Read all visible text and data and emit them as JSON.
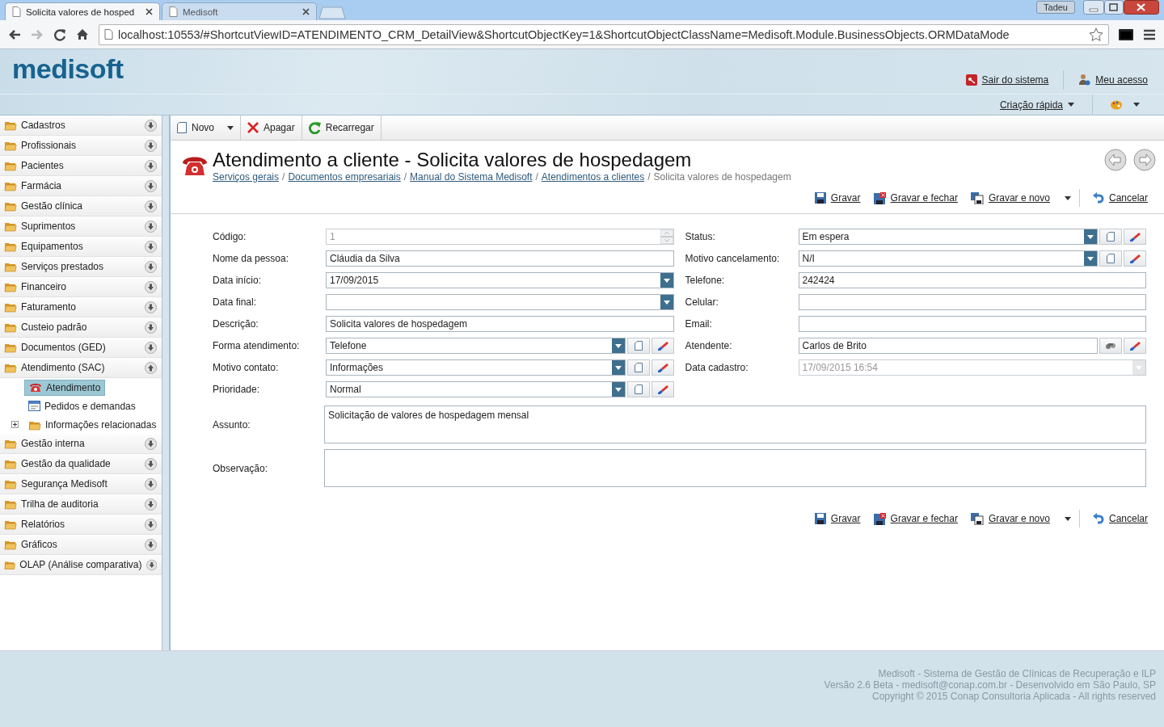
{
  "browser": {
    "tabs": [
      {
        "title": "Solicita valores de hosped",
        "selected": true
      },
      {
        "title": "Medisoft",
        "selected": false
      }
    ],
    "user": "Tadeu",
    "url": "localhost:10553/#ShortcutViewID=ATENDIMENTO_CRM_DetailView&ShortcutObjectKey=1&ShortcutObjectClassName=Medisoft.Module.BusinessObjects.ORMDataMode"
  },
  "header": {
    "logo": "medisoft",
    "links": [
      {
        "label": "Sair do sistema",
        "kind": "exit"
      },
      {
        "label": "Meu acesso",
        "kind": "user"
      }
    ],
    "quick_create": "Criação rápida"
  },
  "sidebar": {
    "items": [
      {
        "label": "Cadastros",
        "expanded": false
      },
      {
        "label": "Profissionais",
        "expanded": false
      },
      {
        "label": "Pacientes",
        "expanded": false
      },
      {
        "label": "Farmácia",
        "expanded": false
      },
      {
        "label": "Gestão clínica",
        "expanded": false
      },
      {
        "label": "Suprimentos",
        "expanded": false
      },
      {
        "label": "Equipamentos",
        "expanded": false
      },
      {
        "label": "Serviços prestados",
        "expanded": false
      },
      {
        "label": "Financeiro",
        "expanded": false
      },
      {
        "label": "Faturamento",
        "expanded": false
      },
      {
        "label": "Custeio padrão",
        "expanded": false
      },
      {
        "label": "Documentos (GED)",
        "expanded": false
      },
      {
        "label": "Atendimento (SAC)",
        "expanded": true,
        "children": [
          {
            "label": "Atendimento",
            "kind": "phone",
            "selected": true,
            "expandable": false
          },
          {
            "label": "Pedidos e demandas",
            "kind": "form",
            "selected": false,
            "expandable": false
          },
          {
            "label": "Informações relacionadas",
            "kind": "folder",
            "selected": false,
            "expandable": true
          }
        ]
      },
      {
        "label": "Gestão interna",
        "expanded": false
      },
      {
        "label": "Gestão da qualidade",
        "expanded": false
      },
      {
        "label": "Segurança Medisoft",
        "expanded": false
      },
      {
        "label": "Trilha de auditoria",
        "expanded": false
      },
      {
        "label": "Relatórios",
        "expanded": false
      },
      {
        "label": "Gráficos",
        "expanded": false
      },
      {
        "label": "OLAP (Análise comparativa)",
        "expanded": false
      }
    ]
  },
  "toolbar": [
    {
      "label": "Novo",
      "kind": "new",
      "dropdown": true
    },
    {
      "label": "Apagar",
      "kind": "delete",
      "dropdown": false
    },
    {
      "label": "Recarregar",
      "kind": "reload",
      "dropdown": false
    }
  ],
  "title": "Atendimento a cliente - Solicita valores de hospedagem",
  "breadcrumb": [
    {
      "label": "Serviços gerais",
      "link": true
    },
    {
      "prefix": "/",
      "label": "Documentos empresariais",
      "link": true
    },
    {
      "prefix": "/",
      "label": "Manual do Sistema Medisoft",
      "link": true
    },
    {
      "prefix": "/",
      "label": "Atendimentos a clientes",
      "link": true
    },
    {
      "prefix": "/",
      "label": "Solicita valores de hospedagem",
      "link": false
    }
  ],
  "actions_top": [
    {
      "label": "Gravar",
      "kind": "save"
    },
    {
      "label": "Gravar e fechar",
      "kind": "save_close"
    },
    {
      "label": "Gravar e novo",
      "kind": "save_new"
    },
    {
      "label": "Cancelar",
      "kind": "cancel"
    }
  ],
  "form": {
    "left": [
      {
        "label": "Código:",
        "value": "1",
        "kind": "spin",
        "disabled": true
      },
      {
        "label": "Nome da pessoa:",
        "value": "Cláudia da Silva",
        "kind": "text",
        "disabled": false
      },
      {
        "label": "Data início:",
        "value": "17/09/2015",
        "kind": "date",
        "disabled": false
      },
      {
        "label": "Data final:",
        "kind": "date",
        "disabled": false
      },
      {
        "label": "Descrição:",
        "value": "Solicita valores de hospedagem",
        "kind": "text",
        "disabled": false
      },
      {
        "label": "Forma atendimento:",
        "value": "Telefone",
        "kind": "combo",
        "disabled": false
      },
      {
        "label": "Motivo contato:",
        "value": "Informações",
        "kind": "combo",
        "disabled": false
      },
      {
        "label": "Prioridade:",
        "value": "Normal",
        "kind": "combo",
        "disabled": false
      }
    ],
    "right": [
      {
        "label": "Status:",
        "value": "Em espera",
        "kind": "combo",
        "disabled": false
      },
      {
        "label": "Motivo cancelamento:",
        "value": "N/I",
        "kind": "combo",
        "disabled": false
      },
      {
        "label": "Telefone:",
        "value": "242424",
        "kind": "text",
        "disabled": false
      },
      {
        "label": "Celular:",
        "kind": "text",
        "disabled": false
      },
      {
        "label": "Email:",
        "kind": "text",
        "disabled": false
      },
      {
        "label": "Atendente:",
        "value": "Carlos de Brito",
        "kind": "lookup",
        "disabled": false
      },
      {
        "label": "Data cadastro:",
        "value": "17/09/2015 16:54",
        "kind": "date",
        "disabled": true
      }
    ],
    "memos": [
      {
        "label": "Assunto:",
        "value": "Solicitação de valores de hospedagem mensal"
      },
      {
        "label": "Observação:"
      }
    ]
  },
  "actions_bottom": [
    {
      "label": "Gravar",
      "kind": "save"
    },
    {
      "label": "Gravar e fechar",
      "kind": "save_close"
    },
    {
      "label": "Gravar e novo",
      "kind": "save_new"
    },
    {
      "label": "Cancelar",
      "kind": "cancel"
    }
  ],
  "footer": [
    "Medisoft - Sistema de Gestão de Clínicas de Recuperação e ILP",
    "Versão 2.6 Beta - medisoft@conap.com.br - Desenvolvido em São Paulo, SP",
    "Copyright © 2015 Conap Consultoria Aplicada - All rights reserved"
  ]
}
